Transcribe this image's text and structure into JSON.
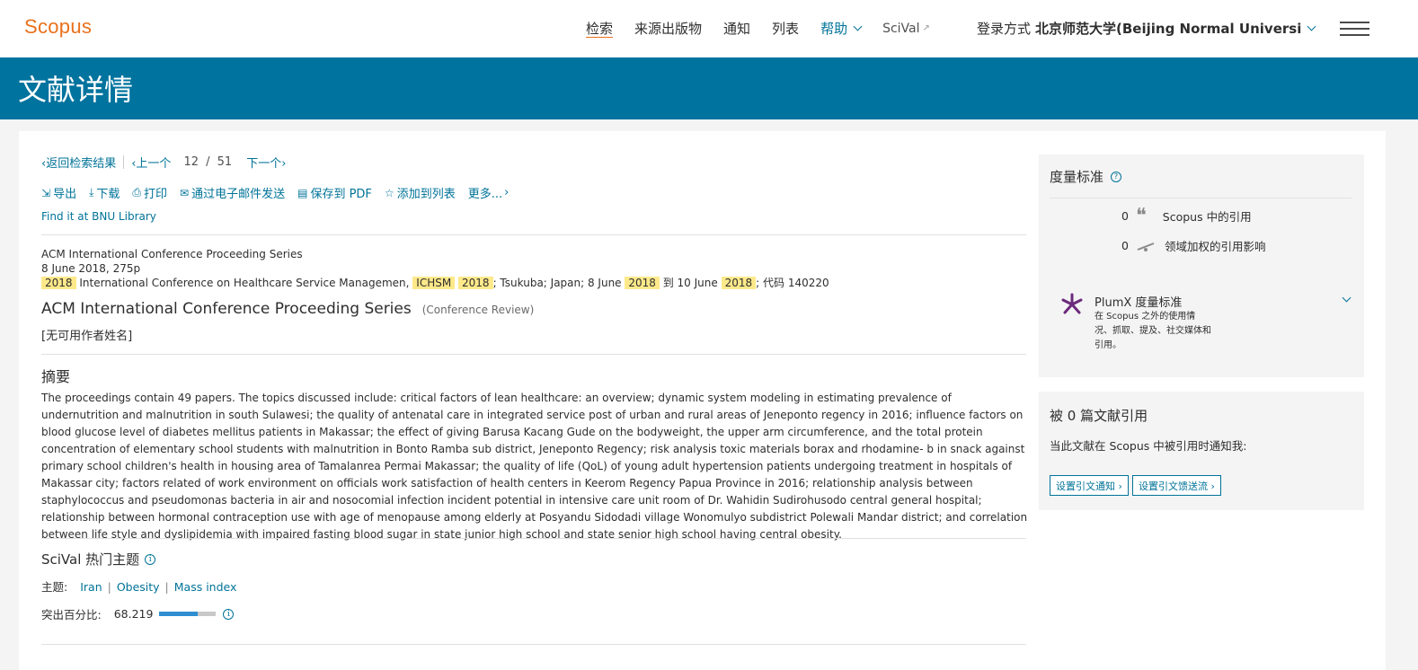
{
  "header": {
    "logo": "Scopus",
    "nav": [
      "检索",
      "来源出版物",
      "通知",
      "列表"
    ],
    "help": "帮助",
    "scival": "SciVal",
    "login_prefix": "登录方式",
    "institution": "北京师范大学(Beijing Normal Universi"
  },
  "banner": {
    "title": "文献详情"
  },
  "crumbs": {
    "back": "返回检索结果",
    "prev": "上一个",
    "current": "12",
    "slash": "/",
    "total": "51",
    "next": "下一个"
  },
  "actions": [
    {
      "icon": "⇲",
      "label": "导出"
    },
    {
      "icon": "⤓",
      "label": "下载"
    },
    {
      "icon": "⎙",
      "label": "打印"
    },
    {
      "icon": "✉",
      "label": "通过电子邮件发送"
    },
    {
      "icon": "▤",
      "label": "保存到 PDF"
    },
    {
      "icon": "☆",
      "label": "添加到列表"
    },
    {
      "icon": "",
      "label": "更多..."
    }
  ],
  "findit": "Find it at BNU Library",
  "meta": {
    "line1": "ACM International Conference Proceeding Series",
    "line2": "8 June 2018, 275p",
    "l3_a": "2018",
    "l3_b": " International Conference on Healthcare Service Managemen, ",
    "l3_c": "ICHSM",
    "l3_d": "2018",
    "l3_e": "; Tsukuba; Japan; 8 June ",
    "l3_f": "2018",
    "l3_g": " 到 10 June ",
    "l3_h": "2018",
    "l3_i": "; 代码 140220"
  },
  "doc": {
    "title": "ACM International Conference Proceeding Series",
    "type": "(Conference Review)",
    "authors": "[无可用作者姓名]"
  },
  "abstract": {
    "heading": "摘要",
    "text": "The proceedings contain 49 papers. The topics discussed include: critical factors of lean healthcare: an overview; dynamic system modeling in estimating prevalence of undernutrition and malnutrition in south Sulawesi; the quality of antenatal care in integrated service post of urban and rural areas of Jeneponto regency in 2016; influence factors on blood glucose level of diabetes mellitus patients in Makassar; the effect of giving Barusa Kacang Gude on the bodyweight, the upper arm circumference, and the total protein concentration of elementary school students with malnutrition in Bonto Ramba sub district, Jeneponto Regency; risk analysis toxic materials borax and rhodamine- b in snack against primary school children's health in housing area of Tamalanrea Permai Makassar; the quality of life (QoL) of young adult hypertension patients undergoing treatment in hospitals of Makassar city; factors related of work environment on officials work satisfaction of health centers in Keerom Regency Papua Province in 2016; relationship analysis between staphylococcus and pseudomonas bacteria in air and nosocomial infection incident potential in intensive care unit room of Dr. Wahidin Sudirohusodo central general hospital; relationship between hormonal contraception use with age of menopause among elderly at Posyandu Sidodadi village Wonomulyo subdistrict Polewali Mandar district; and correlation between life style and dyslipidemia with impaired fasting blood sugar in state junior high school and state senior high school having central obesity."
  },
  "topics": {
    "heading": "SciVal 热门主题",
    "label": "主题:",
    "items": [
      "Iran",
      "Obesity",
      "Mass index"
    ],
    "sep": "|",
    "pct_label": "突出百分比:",
    "pct_value": "68.219",
    "pct_fraction": 0.68219
  },
  "metrics": {
    "heading": "度量标准",
    "cite_count": "0",
    "cite_label": "Scopus 中的引用",
    "fwci_count": "0",
    "fwci_label": "领域加权的引用影响",
    "plumx_title": "PlumX 度量标准",
    "plumx_desc": "在 Scopus 之外的使用情况、抓取、提及、社交媒体和引用。"
  },
  "cited": {
    "heading": "被 0 篇文献引用",
    "notify": "当此文献在 Scopus 中被引用时通知我:",
    "btn_alert": "设置引文通知 ›",
    "btn_feed": "设置引文馈送流 ›"
  },
  "colors": {
    "brand_orange": "#e9711c",
    "banner_blue": "#00739e",
    "link_blue": "#007398",
    "highlight": "#fde98a",
    "plumx_purple": "#6b2a7b"
  }
}
